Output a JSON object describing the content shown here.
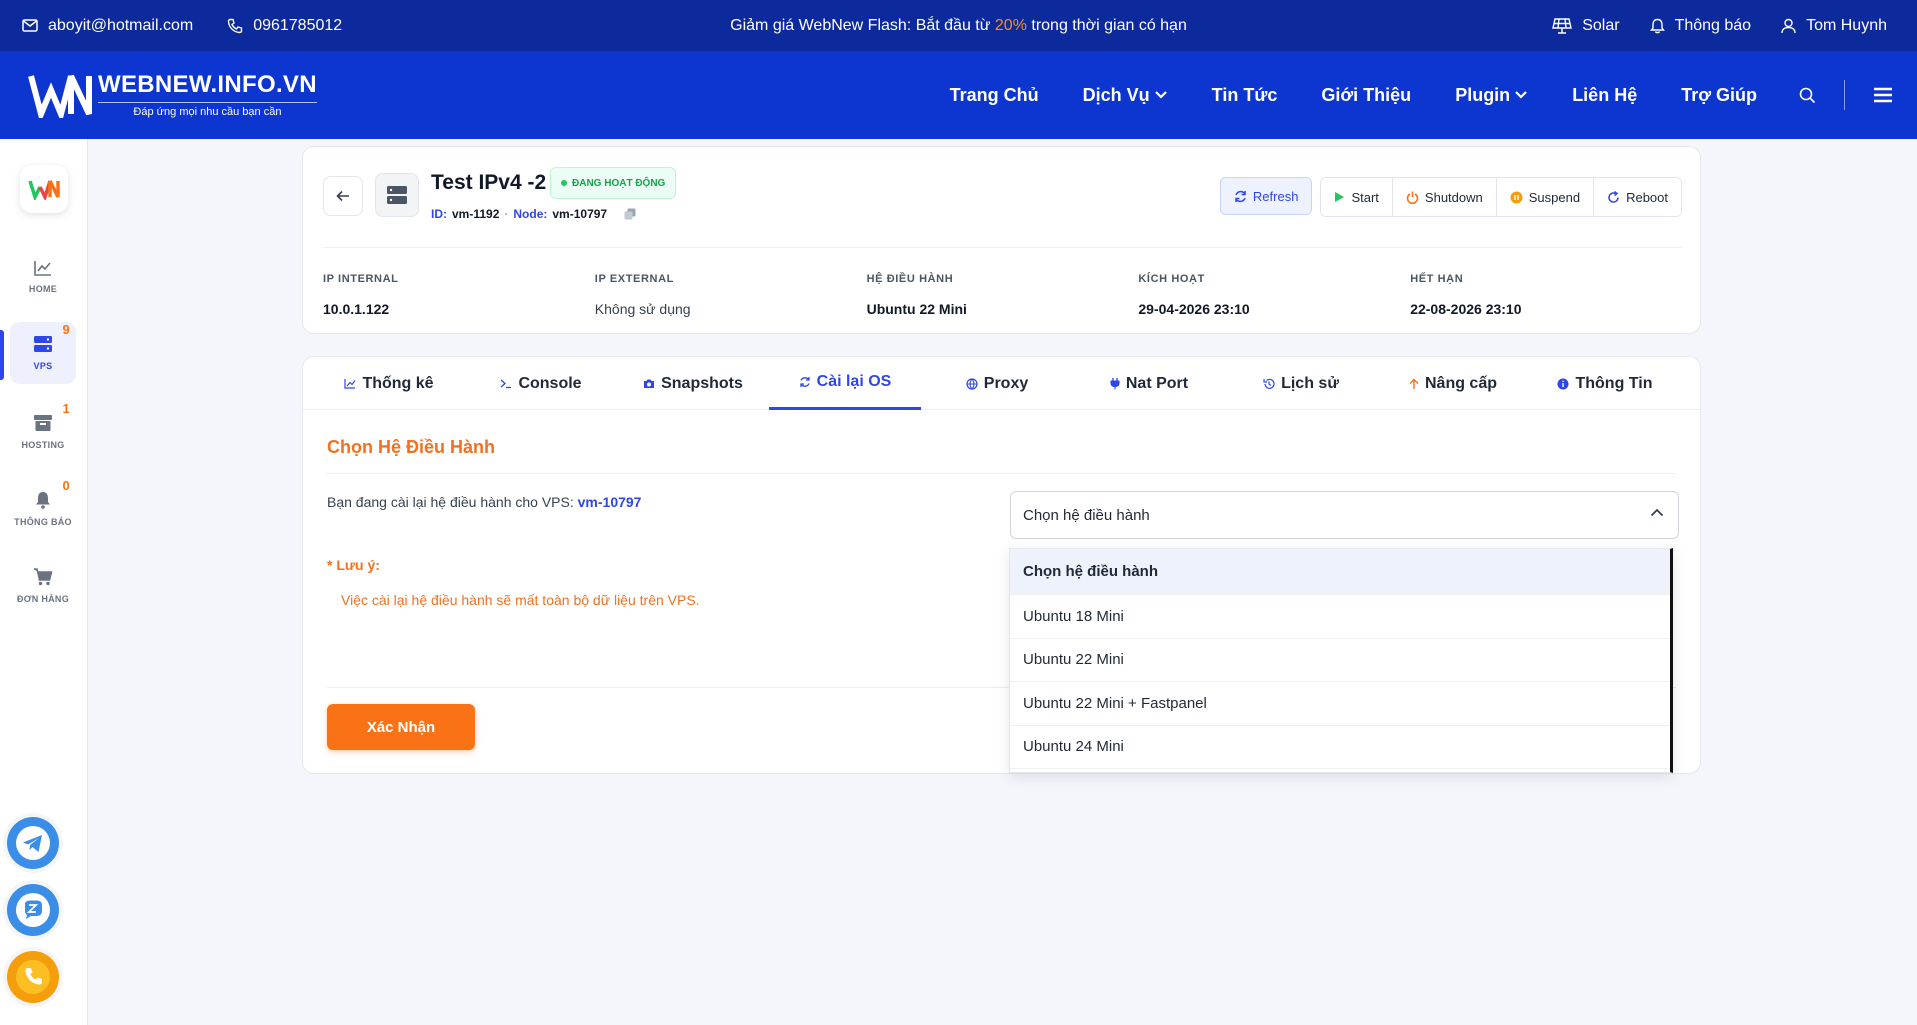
{
  "topbar": {
    "email": "aboyit@hotmail.com",
    "phone": "0961785012",
    "promo_prefix": "Giảm giá WebNew Flash: Bắt đầu từ ",
    "promo_highlight": "20%",
    "promo_suffix": " trong thời gian có hạn",
    "solar": "Solar",
    "notifications": "Thông báo",
    "user": "Tom Huynh"
  },
  "brand": {
    "name": "WEBNEW.INFO.VN",
    "tagline": "Đáp ứng mọi nhu cầu bạn cần"
  },
  "nav": {
    "items": [
      "Trang Chủ",
      "Dịch Vụ",
      "Tin Tức",
      "Giới Thiệu",
      "Plugin",
      "Liên Hệ",
      "Trợ Giúp"
    ]
  },
  "sidebar": {
    "items": [
      {
        "label": "HOME",
        "badge": ""
      },
      {
        "label": "VPS",
        "badge": "9"
      },
      {
        "label": "HOSTING",
        "badge": "1"
      },
      {
        "label": "THÔNG BÁO",
        "badge": "0"
      },
      {
        "label": "ĐƠN HÀNG",
        "badge": ""
      }
    ]
  },
  "vm": {
    "name": "Test IPv4 -2",
    "status": "ĐANG HOẠT ĐỘNG",
    "id_label": "ID:",
    "id": "vm-1192",
    "node_label": "Node:",
    "node": "vm-10797"
  },
  "actions": {
    "refresh": "Refresh",
    "start": "Start",
    "shutdown": "Shutdown",
    "suspend": "Suspend",
    "reboot": "Reboot"
  },
  "info": [
    {
      "label": "IP INTERNAL",
      "value": "10.0.1.122"
    },
    {
      "label": "IP EXTERNAL",
      "value": "Không sử dụng"
    },
    {
      "label": "HỆ ĐIỀU HÀNH",
      "value": "Ubuntu 22 Mini"
    },
    {
      "label": "KÍCH HOẠT",
      "value": "29-04-2026 23:10"
    },
    {
      "label": "HẾT HẠN",
      "value": "22-08-2026 23:10"
    }
  ],
  "tabs": [
    "Thống kê",
    "Console",
    "Snapshots",
    "Cài lại OS",
    "Proxy",
    "Nat Port",
    "Lịch sử",
    "Nâng cấp",
    "Thông Tin"
  ],
  "reinstall": {
    "title": "Chọn Hệ Điều Hành",
    "text": "Bạn đang cài lại hệ điều hành cho VPS: ",
    "vps": "vm-10797",
    "note_star": "*",
    "note_label": " Lưu ý:",
    "note_text": "Việc cài lại hệ điều hành sẽ mất toàn bộ dữ liệu trên VPS.",
    "confirm": "Xác Nhận",
    "select_value": "Chọn hệ điều hành"
  },
  "os_options": [
    "Chọn hệ điều hành",
    "Ubuntu 18 Mini",
    "Ubuntu 22 Mini",
    "Ubuntu 22 Mini + Fastpanel",
    "Ubuntu 24 Mini"
  ],
  "colors": {
    "topbar": "#0c2a9c",
    "navbar": "#0d36d1",
    "accent": "#2f46e8",
    "orange": "#f97316",
    "success": "#16a34a"
  }
}
